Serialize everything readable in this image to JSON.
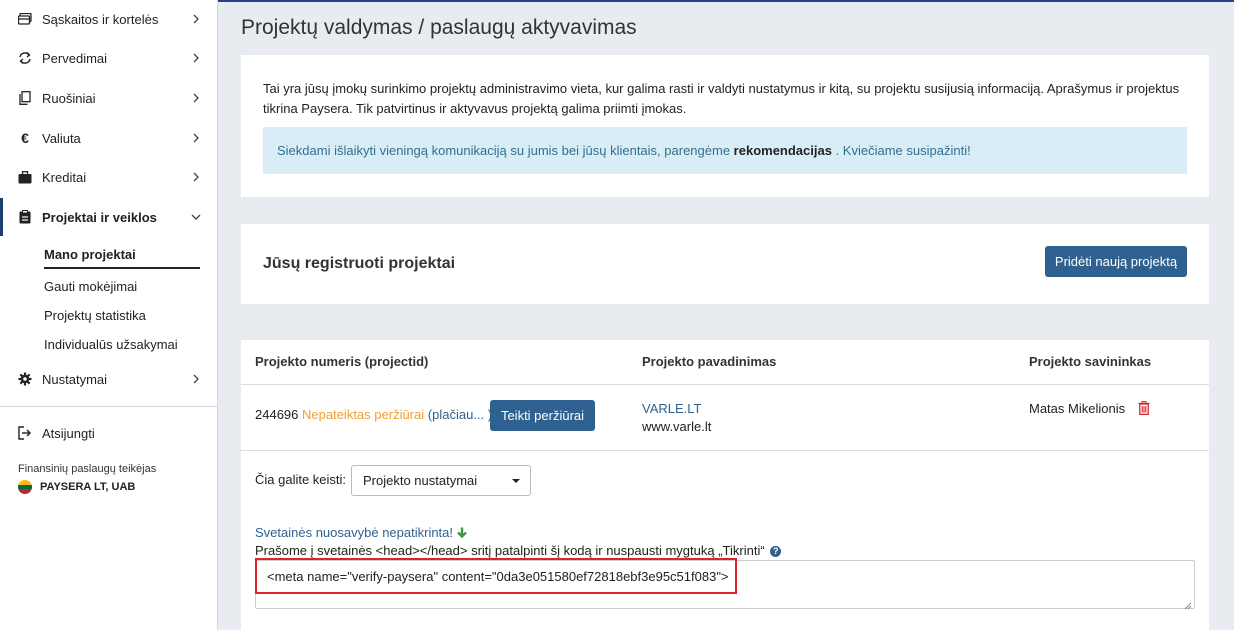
{
  "sidebar": {
    "items": [
      {
        "label": "Sąskaitos ir kortelės",
        "icon": "cards-icon"
      },
      {
        "label": "Pervedimai",
        "icon": "transfer-icon"
      },
      {
        "label": "Ruošiniai",
        "icon": "copy-icon"
      },
      {
        "label": "Valiuta",
        "icon": "euro-icon"
      },
      {
        "label": "Kreditai",
        "icon": "briefcase-icon"
      },
      {
        "label": "Projektai ir veiklos",
        "icon": "clipboard-icon"
      },
      {
        "label": "Nustatymai",
        "icon": "gear-icon"
      },
      {
        "label": "Atsijungti",
        "icon": "logout-icon"
      }
    ],
    "subitems": [
      "Mano projektai",
      "Gauti mokėjimai",
      "Projektų statistika",
      "Individualūs užsakymai"
    ],
    "financial_label": "Finansinių paslaugų teikėjas",
    "company": "PAYSERA LT, UAB"
  },
  "main": {
    "title": "Projektų valdymas / paslaugų aktyvavimas",
    "intro": "Tai yra jūsų įmokų surinkimo projektų administravimo vieta, kur galima rasti ir valdyti nustatymus ir kitą, su projektu susijusią informaciją. Aprašymus ir projektus tikrina Paysera. Tik patvirtinus ir aktyvavus projektą galima priimti įmokas.",
    "info_pre": "Siekdami išlaikyti vieningą komunikaciją su jumis bei jūsų klientais, parengėme",
    "info_bold": "rekomendacijas",
    "info_post": ". Kviečiame susipažinti!",
    "registered_title": "Jūsų registruoti projektai",
    "add_button": "Pridėti naują projektą",
    "table": {
      "headers": [
        "Projekto numeris (projectid)",
        "Projekto pavadinimas",
        "Projekto savininkas"
      ],
      "row": {
        "id": "244696",
        "status": "Nepateiktas peržiūrai",
        "paren_open": "(",
        "more_link": "plačiau...",
        "paren_close": ")",
        "review_button": "Teikti peržiūrai",
        "name": "VARLE.LT",
        "url": "www.varle.lt",
        "owner": "Matas Mikelionis"
      }
    },
    "edit_label": "Čia galite keisti:",
    "edit_select": "Projekto nustatymai",
    "ownership_status": "Svetainės nuosavybė nepatikrinta!",
    "instructions": "Prašome į svetainės <head></head> sritį patalpinti šį kodą ir nuspausti mygtuką „Tikrinti“",
    "meta_code": "<meta name=\"verify-paysera\" content=\"0da3e051580ef72818ebf3e95c51f083\">"
  },
  "colors": {
    "primary": "#2f6190",
    "accent_orange": "#f0a030",
    "info_bg": "#d9edf7",
    "danger": "#d9262a",
    "success": "#3c9a3c"
  }
}
